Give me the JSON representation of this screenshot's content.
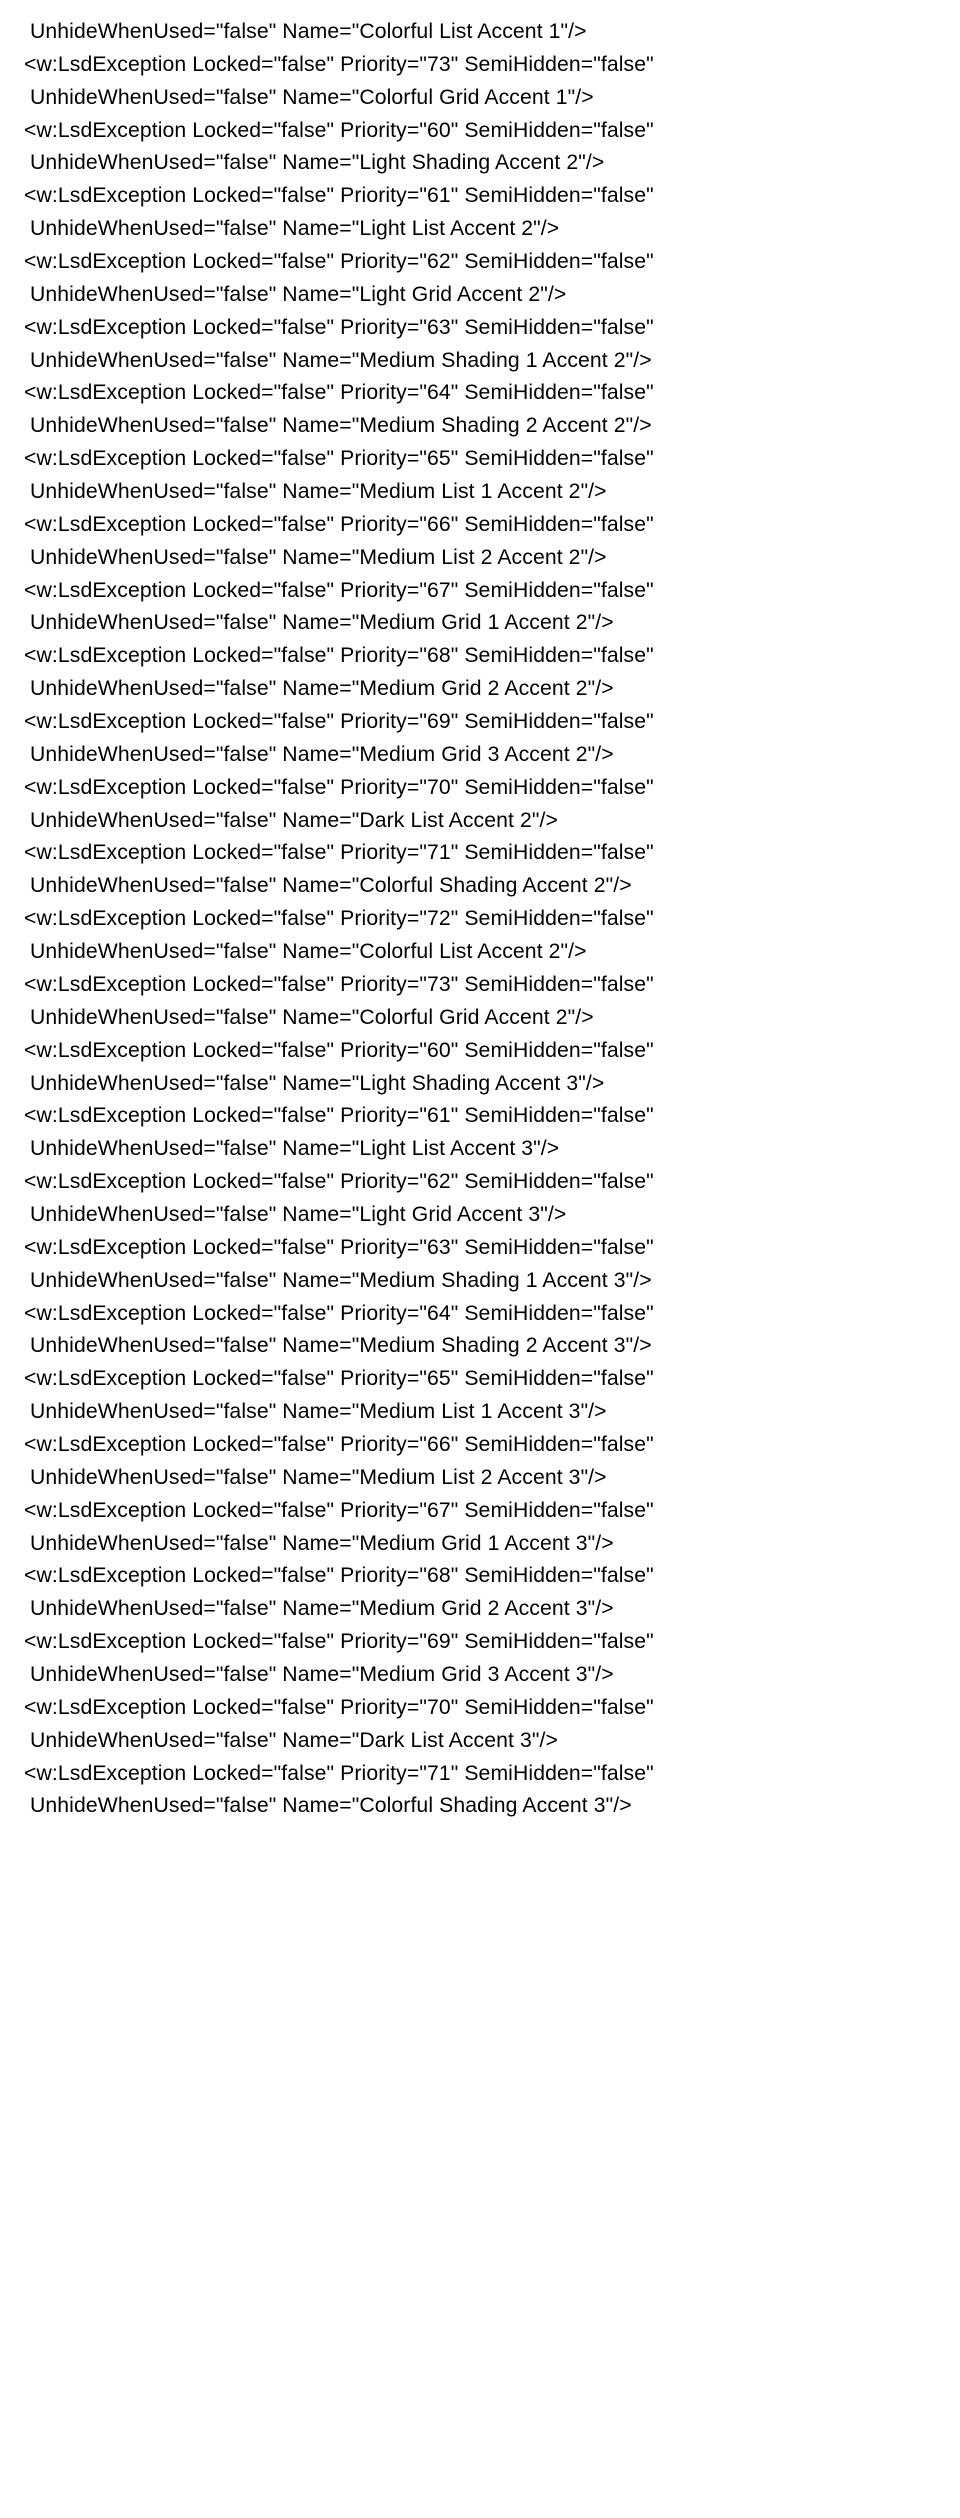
{
  "lines": [
    " UnhideWhenUsed=\"false\" Name=\"Colorful List Accent 1\"/>",
    "<w:LsdException Locked=\"false\" Priority=\"73\" SemiHidden=\"false\"",
    " UnhideWhenUsed=\"false\" Name=\"Colorful Grid Accent 1\"/>",
    "<w:LsdException Locked=\"false\" Priority=\"60\" SemiHidden=\"false\"",
    " UnhideWhenUsed=\"false\" Name=\"Light Shading Accent 2\"/>",
    "<w:LsdException Locked=\"false\" Priority=\"61\" SemiHidden=\"false\"",
    " UnhideWhenUsed=\"false\" Name=\"Light List Accent 2\"/>",
    "<w:LsdException Locked=\"false\" Priority=\"62\" SemiHidden=\"false\"",
    " UnhideWhenUsed=\"false\" Name=\"Light Grid Accent 2\"/>",
    "<w:LsdException Locked=\"false\" Priority=\"63\" SemiHidden=\"false\"",
    " UnhideWhenUsed=\"false\" Name=\"Medium Shading 1 Accent 2\"/>",
    "<w:LsdException Locked=\"false\" Priority=\"64\" SemiHidden=\"false\"",
    " UnhideWhenUsed=\"false\" Name=\"Medium Shading 2 Accent 2\"/>",
    "<w:LsdException Locked=\"false\" Priority=\"65\" SemiHidden=\"false\"",
    " UnhideWhenUsed=\"false\" Name=\"Medium List 1 Accent 2\"/>",
    "<w:LsdException Locked=\"false\" Priority=\"66\" SemiHidden=\"false\"",
    " UnhideWhenUsed=\"false\" Name=\"Medium List 2 Accent 2\"/>",
    "<w:LsdException Locked=\"false\" Priority=\"67\" SemiHidden=\"false\"",
    " UnhideWhenUsed=\"false\" Name=\"Medium Grid 1 Accent 2\"/>",
    "<w:LsdException Locked=\"false\" Priority=\"68\" SemiHidden=\"false\"",
    " UnhideWhenUsed=\"false\" Name=\"Medium Grid 2 Accent 2\"/>",
    "<w:LsdException Locked=\"false\" Priority=\"69\" SemiHidden=\"false\"",
    " UnhideWhenUsed=\"false\" Name=\"Medium Grid 3 Accent 2\"/>",
    "<w:LsdException Locked=\"false\" Priority=\"70\" SemiHidden=\"false\"",
    " UnhideWhenUsed=\"false\" Name=\"Dark List Accent 2\"/>",
    "<w:LsdException Locked=\"false\" Priority=\"71\" SemiHidden=\"false\"",
    " UnhideWhenUsed=\"false\" Name=\"Colorful Shading Accent 2\"/>",
    "<w:LsdException Locked=\"false\" Priority=\"72\" SemiHidden=\"false\"",
    " UnhideWhenUsed=\"false\" Name=\"Colorful List Accent 2\"/>",
    "<w:LsdException Locked=\"false\" Priority=\"73\" SemiHidden=\"false\"",
    " UnhideWhenUsed=\"false\" Name=\"Colorful Grid Accent 2\"/>",
    "<w:LsdException Locked=\"false\" Priority=\"60\" SemiHidden=\"false\"",
    " UnhideWhenUsed=\"false\" Name=\"Light Shading Accent 3\"/>",
    "<w:LsdException Locked=\"false\" Priority=\"61\" SemiHidden=\"false\"",
    " UnhideWhenUsed=\"false\" Name=\"Light List Accent 3\"/>",
    "<w:LsdException Locked=\"false\" Priority=\"62\" SemiHidden=\"false\"",
    " UnhideWhenUsed=\"false\" Name=\"Light Grid Accent 3\"/>",
    "<w:LsdException Locked=\"false\" Priority=\"63\" SemiHidden=\"false\"",
    " UnhideWhenUsed=\"false\" Name=\"Medium Shading 1 Accent 3\"/>",
    "<w:LsdException Locked=\"false\" Priority=\"64\" SemiHidden=\"false\"",
    " UnhideWhenUsed=\"false\" Name=\"Medium Shading 2 Accent 3\"/>",
    "<w:LsdException Locked=\"false\" Priority=\"65\" SemiHidden=\"false\"",
    " UnhideWhenUsed=\"false\" Name=\"Medium List 1 Accent 3\"/>",
    "<w:LsdException Locked=\"false\" Priority=\"66\" SemiHidden=\"false\"",
    " UnhideWhenUsed=\"false\" Name=\"Medium List 2 Accent 3\"/>",
    "<w:LsdException Locked=\"false\" Priority=\"67\" SemiHidden=\"false\"",
    " UnhideWhenUsed=\"false\" Name=\"Medium Grid 1 Accent 3\"/>",
    "<w:LsdException Locked=\"false\" Priority=\"68\" SemiHidden=\"false\"",
    " UnhideWhenUsed=\"false\" Name=\"Medium Grid 2 Accent 3\"/>",
    "<w:LsdException Locked=\"false\" Priority=\"69\" SemiHidden=\"false\"",
    " UnhideWhenUsed=\"false\" Name=\"Medium Grid 3 Accent 3\"/>",
    "<w:LsdException Locked=\"false\" Priority=\"70\" SemiHidden=\"false\"",
    " UnhideWhenUsed=\"false\" Name=\"Dark List Accent 3\"/>",
    "<w:LsdException Locked=\"false\" Priority=\"71\" SemiHidden=\"false\"",
    " UnhideWhenUsed=\"false\" Name=\"Colorful Shading Accent 3\"/>"
  ]
}
